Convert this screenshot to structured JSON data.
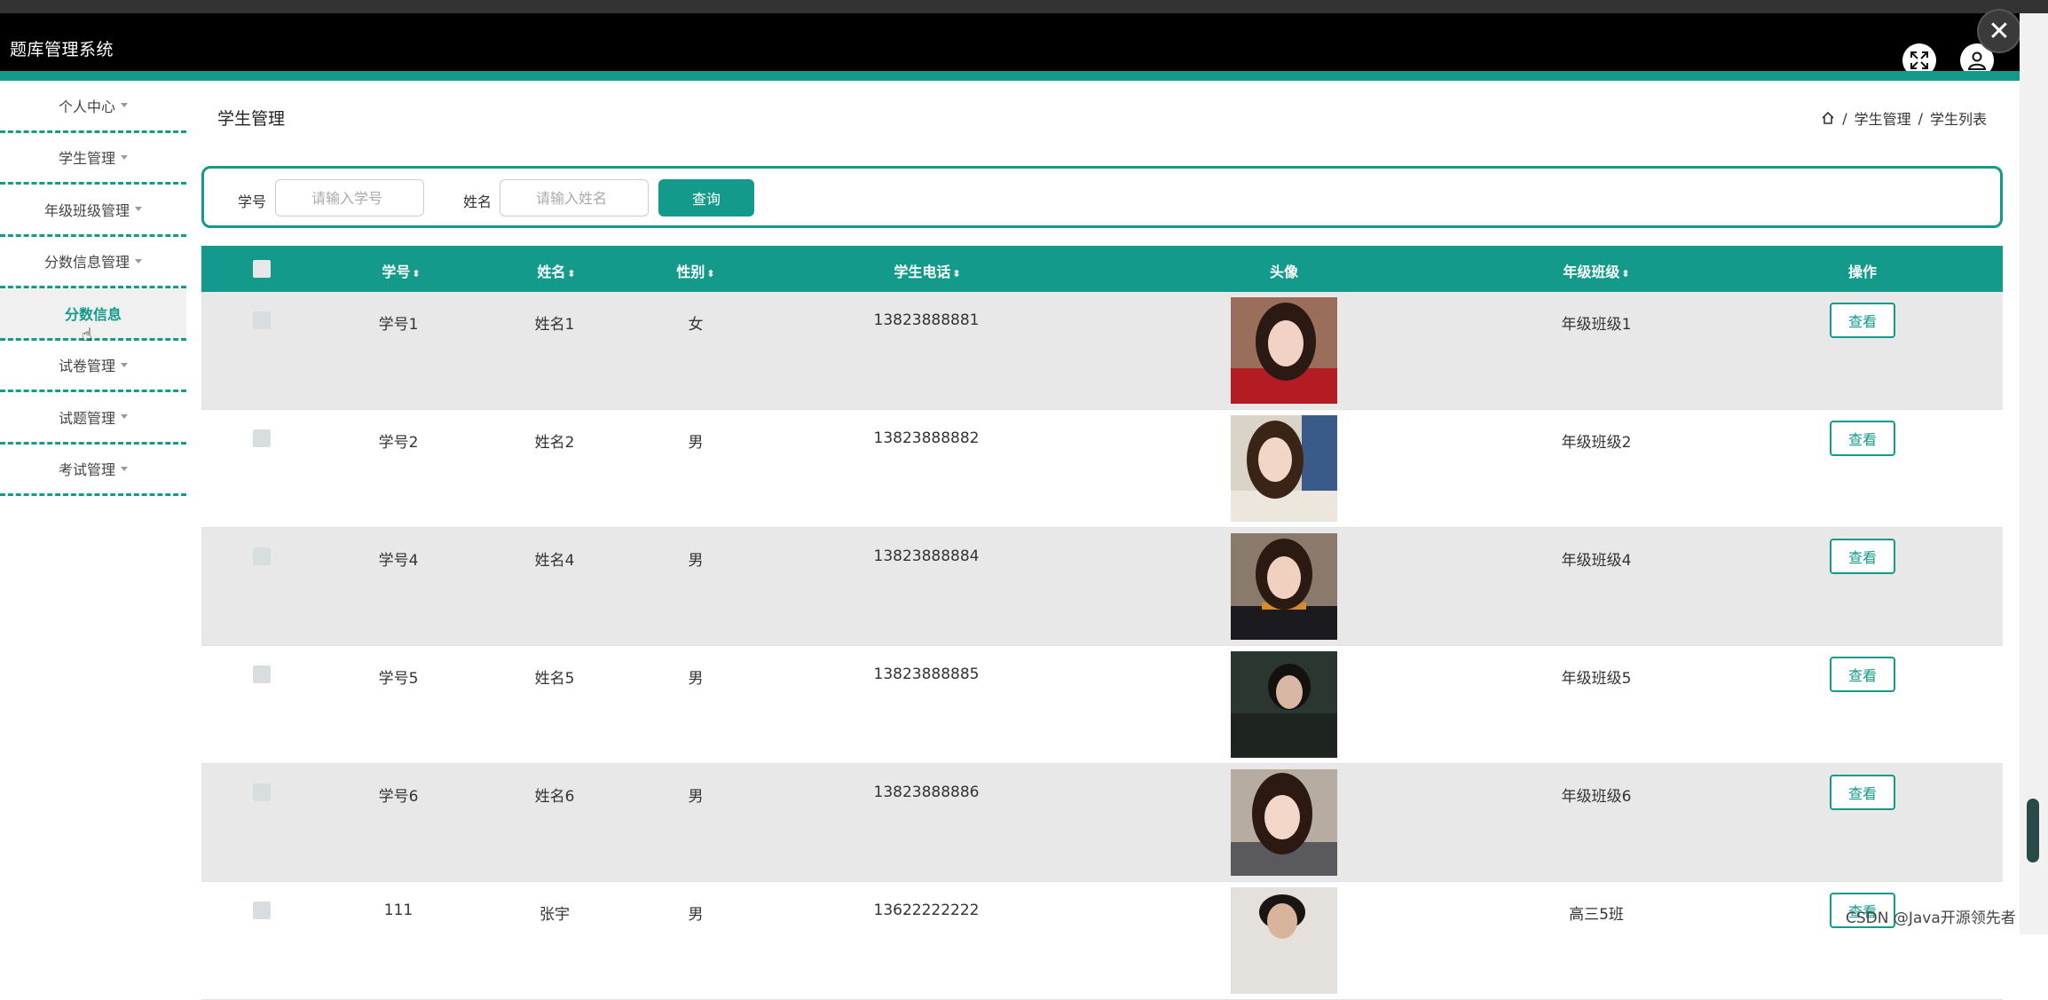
{
  "app": {
    "title": "题库管理系统"
  },
  "sidebar": {
    "items": [
      {
        "label": "个人中心"
      },
      {
        "label": "学生管理"
      },
      {
        "label": "年级班级管理"
      },
      {
        "label": "分数信息管理"
      },
      {
        "label": "分数信息"
      },
      {
        "label": "试卷管理"
      },
      {
        "label": "试题管理"
      },
      {
        "label": "考试管理"
      }
    ]
  },
  "page": {
    "title": "学生管理"
  },
  "breadcrumb": {
    "items": [
      "学生管理",
      "学生列表"
    ],
    "sep": "/"
  },
  "search": {
    "id_label": "学号",
    "id_placeholder": "请输入学号",
    "name_label": "姓名",
    "name_placeholder": "请输入姓名",
    "button": "查询"
  },
  "table": {
    "headers": [
      "学号",
      "姓名",
      "性别",
      "学生电话",
      "头像",
      "年级班级",
      "操作"
    ],
    "sort_mark": "⬍",
    "view_label": "查看",
    "rows": [
      {
        "id": "学号1",
        "name": "姓名1",
        "gender": "女",
        "phone": "13823888881",
        "class": "年级班级1"
      },
      {
        "id": "学号2",
        "name": "姓名2",
        "gender": "男",
        "phone": "13823888882",
        "class": "年级班级2"
      },
      {
        "id": "学号4",
        "name": "姓名4",
        "gender": "男",
        "phone": "13823888884",
        "class": "年级班级4"
      },
      {
        "id": "学号5",
        "name": "姓名5",
        "gender": "男",
        "phone": "13823888885",
        "class": "年级班级5"
      },
      {
        "id": "学号6",
        "name": "姓名6",
        "gender": "男",
        "phone": "13823888886",
        "class": "年级班级6"
      },
      {
        "id": "111",
        "name": "张宇",
        "gender": "男",
        "phone": "13622222222",
        "class": "高三5班"
      }
    ]
  },
  "watermark": "CSDN @Java开源领先者",
  "icons": {
    "fullscreen": "fullscreen-icon",
    "user": "user-icon",
    "close": "close-icon",
    "home": "home-icon"
  },
  "colors": {
    "accent": "#139a8a",
    "header": "#000000"
  }
}
